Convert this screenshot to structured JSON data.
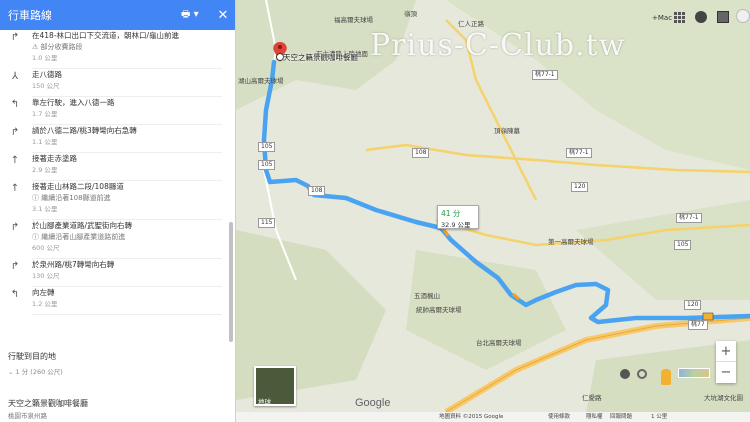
{
  "panel": {
    "title": "行車路線",
    "print_label": "🖶 ▾",
    "close_label": "✕",
    "steps": [
      {
        "icon": "↱",
        "text": "在418-林口出口下交流道，朝林口/龜山前進",
        "sub": "⚠ 部分收費路段",
        "dist": "1.0 公里"
      },
      {
        "icon": "⅄",
        "text": "走八德路",
        "sub": "",
        "dist": "150 公尺"
      },
      {
        "icon": "↰",
        "text": "靠左行駛，進入八德一路",
        "sub": "",
        "dist": "1.7 公里"
      },
      {
        "icon": "↱",
        "text": "請於八德二路/桃3轉彎向右急轉",
        "sub": "",
        "dist": "1.1 公里"
      },
      {
        "icon": "↑",
        "text": "接著走赤塗路",
        "sub": "",
        "dist": "2.9 公里"
      },
      {
        "icon": "↑",
        "text": "接著走山林路二段/108縣道",
        "sub": "ⓘ 繼續沿著108縣道前進",
        "dist": "3.1 公里"
      },
      {
        "icon": "↱",
        "text": "於山腳產業道路/武聖街向右轉",
        "sub": "ⓘ 繼續沿著山腳產業道路前進",
        "dist": "600 公尺"
      },
      {
        "icon": "↱",
        "text": "於泉州路/桃7轉彎向右轉",
        "sub": "",
        "dist": "130 公尺"
      },
      {
        "icon": "↰",
        "text": "向左轉",
        "sub": "",
        "dist": "1.2 公里"
      }
    ],
    "arrive_title": "行駛到目的地",
    "arrive_sub": "⌄ 1 分 (260 公尺)",
    "dest_name": "天空之籟景觀咖啡餐廳",
    "dest_address": "桃園市泉州路"
  },
  "map": {
    "watermark": "Prius-C-Club.tw",
    "dest_label": "天空之籟景觀咖啡餐廳",
    "time": "41 分",
    "distance": "32.9 公里",
    "top_right_text": "+Mac",
    "thumb_label": "地球",
    "google_label": "Google",
    "route_color": "#4aa3f0",
    "places": [
      {
        "text": "福高爾夫球場"
      },
      {
        "text": "嶺頂"
      },
      {
        "text": "仁人正路"
      },
      {
        "text": "石大溝降上陸地面"
      },
      {
        "text": "湖山高爾夫球場"
      },
      {
        "text": "頂嶺陳墓"
      },
      {
        "text": "第一高爾夫球場"
      },
      {
        "text": "五酒楓山"
      },
      {
        "text": "統帥高爾夫球場"
      },
      {
        "text": "台北高爾夫球場"
      },
      {
        "text": "仁愛路"
      },
      {
        "text": "大坑湖文化園"
      }
    ],
    "roads": [
      {
        "text": "108"
      },
      {
        "text": "108"
      },
      {
        "text": "105"
      },
      {
        "text": "105"
      },
      {
        "text": "115"
      },
      {
        "text": "桃77-1"
      },
      {
        "text": "桃77-1"
      },
      {
        "text": "桃77-1"
      },
      {
        "text": "120"
      },
      {
        "text": "120"
      },
      {
        "text": "105"
      },
      {
        "text": "桃77"
      }
    ],
    "footer": {
      "data": "地圖資料 ©2015 Google",
      "terms": "使用條款",
      "privacy": "隱私權",
      "report": "回報問題",
      "scale": "1 公里"
    }
  }
}
